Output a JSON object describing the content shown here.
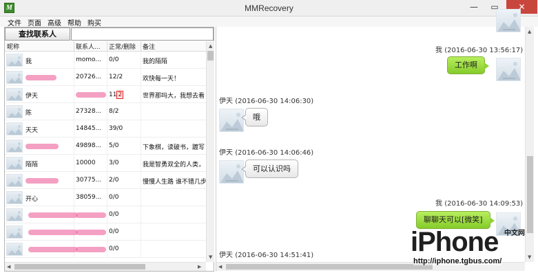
{
  "window": {
    "title": "MMRecovery",
    "app_icon": "M",
    "controls": {
      "minimize": "—",
      "maximize": "▭",
      "close": "✕"
    }
  },
  "menu": [
    "文件",
    "页面",
    "高级",
    "帮助",
    "购买"
  ],
  "search": {
    "button_label": "查找联系人",
    "value": ""
  },
  "contacts_table": {
    "columns": [
      "昵称",
      "联系人...",
      "正常/删除",
      "备注"
    ],
    "rows": [
      {
        "name": "我",
        "contact": "momo...",
        "count": "0/0",
        "note": "我的陌陌"
      },
      {
        "name": "",
        "contact": "20726...",
        "count": "12/2",
        "note": "欢快每一天！"
      },
      {
        "name": "伊天",
        "contact": "",
        "count_normal": "11",
        "count_deleted": "2",
        "note": "世界那吗大，我想去看"
      },
      {
        "name": "陈",
        "contact": "27328...",
        "count": "8/2",
        "note": ""
      },
      {
        "name": "天天",
        "contact": "14845...",
        "count": "39/0",
        "note": ""
      },
      {
        "name": "",
        "contact": "49898...",
        "count": "5/0",
        "note": "下象棋，读破书，踱写"
      },
      {
        "name": "陌陌",
        "contact": "10000",
        "count": "3/0",
        "note": "我是智勇双全的人类，"
      },
      {
        "name": "",
        "contact": "30775...",
        "count": "2/0",
        "note": "慢慢人生路 谁不错几步"
      },
      {
        "name": "开心",
        "contact": "38059...",
        "count": "0/0",
        "note": ""
      },
      {
        "name": "",
        "contact": "",
        "count": "0/0",
        "note": ""
      },
      {
        "name": "",
        "contact": "",
        "count": "0/0",
        "note": ""
      },
      {
        "name": "",
        "contact": "",
        "count": "0/0",
        "note": ""
      }
    ]
  },
  "chat": {
    "messages": [
      {
        "sender": "我",
        "time": "(2016-06-30 13:56:17)",
        "text": "工作啊",
        "side": "right"
      },
      {
        "sender": "伊天",
        "time": "(2016-06-30 14:06:30)",
        "text": "哦",
        "side": "left"
      },
      {
        "sender": "伊天",
        "time": "(2016-06-30 14:06:46)",
        "text": "可以认识吗",
        "side": "left"
      },
      {
        "sender": "我",
        "time": "(2016-06-30 14:09:53)",
        "text": "聊聊天可以[微笑]",
        "side": "right"
      },
      {
        "sender": "伊天",
        "time": "(2016-06-30 14:51:41)",
        "text": "",
        "side": "left"
      }
    ]
  },
  "watermark": {
    "logo": "iPhone",
    "logo_cn": "中文网",
    "url": "http://iphone.tgbus.com/"
  },
  "colors": {
    "bubble_green": "#9ddb44",
    "close_red": "#c9463d",
    "redaction_pink": "#f078aa",
    "highlight_red": "#e02020"
  },
  "icons": {
    "avatar": "landscape-placeholder-icon"
  }
}
